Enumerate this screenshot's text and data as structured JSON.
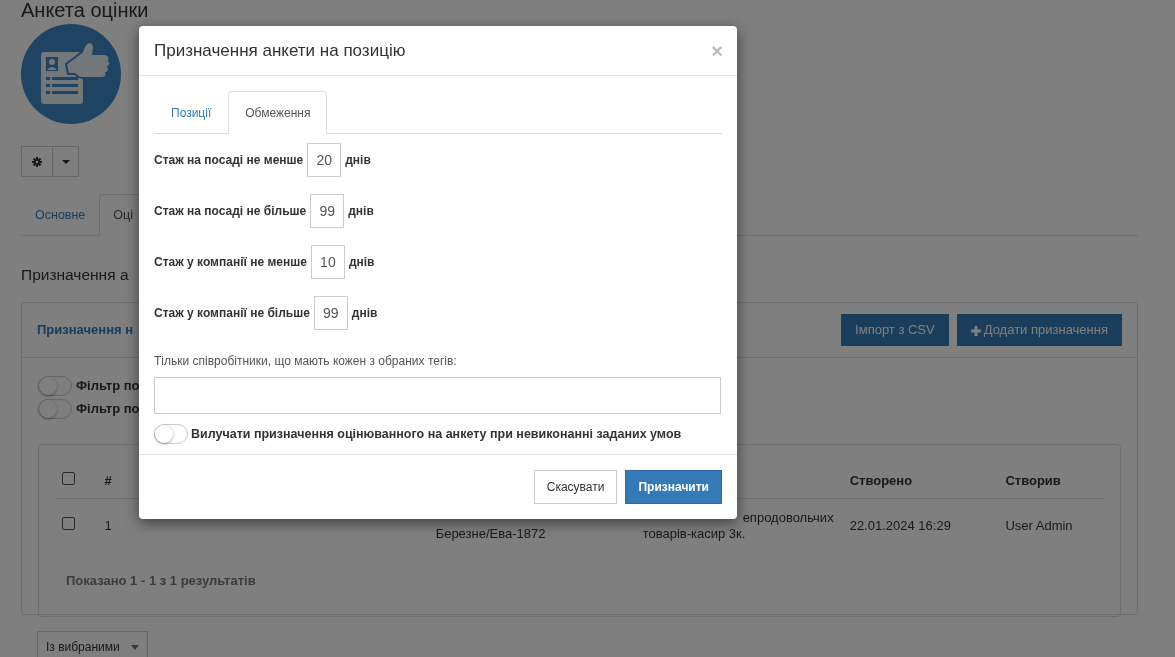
{
  "page": {
    "title": "Анкета оцінки",
    "tabs": [
      {
        "label": "Основне",
        "selected": false
      },
      {
        "label": "Оці",
        "selected": true
      }
    ],
    "section_title": "Призначення а",
    "card": {
      "title": "Призначення н",
      "buttons": [
        {
          "label": "Імпорт з CSV",
          "kind": "plain"
        },
        {
          "label": "Додати призначення",
          "kind": "add"
        }
      ],
      "filters": [
        {
          "label": "Фільтр по",
          "on": false
        },
        {
          "label": "Фільтр по",
          "on": false
        }
      ],
      "table": {
        "header": {
          "checked": false,
          "number": "#",
          "created": "Створено",
          "author": "Створив"
        },
        "rows": [
          {
            "checked": false,
            "number": "1",
            "location": "Березне/Ева-1872",
            "position": [
              "епродовольчих",
              "товарів-касир 3к."
            ],
            "created": "22.01.2024 16:29",
            "author": "User Admin"
          }
        ],
        "summary": "Показано 1 - 1 з 1 результатів"
      }
    },
    "bulk_select": "Із вибраними"
  },
  "modal": {
    "title": "Призначення анкети на позицію",
    "close": "×",
    "tabs": [
      {
        "label": "Позиції",
        "selected": false
      },
      {
        "label": "Обмеження",
        "selected": true
      }
    ],
    "limits": [
      {
        "label": "Стаж на посаді не менше",
        "value": "20",
        "unit": "днів"
      },
      {
        "label": "Стаж на посаді не більше",
        "value": "99",
        "unit": "днів"
      },
      {
        "label": "Стаж у компанії не менше",
        "value": "10",
        "unit": "днів"
      },
      {
        "label": "Стаж у компанії не більше",
        "value": "99",
        "unit": "днів"
      }
    ],
    "tags": {
      "label": "Тільки співробітники, що мають кожен з обраних тегів:"
    },
    "exclude_toggle": {
      "label": "Вилучати призначення оцінюванного на анкету при невиконанні заданих умов",
      "on": false
    },
    "buttons": [
      {
        "label": "Скасувати",
        "kind": "secondary"
      },
      {
        "label": "Призначити",
        "kind": "primary"
      }
    ]
  }
}
